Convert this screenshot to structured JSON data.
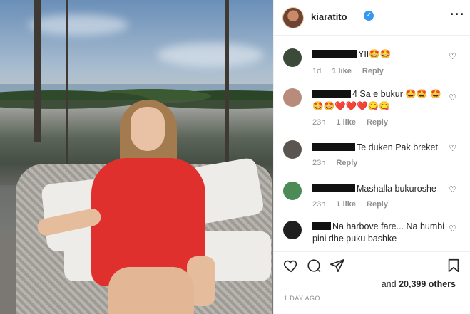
{
  "post": {
    "username": "kiaratito",
    "verified_label": "✓",
    "more_label": "···"
  },
  "comments": [
    {
      "text": "YII🤩🤩",
      "time": "1d",
      "likes": "1 like",
      "reply": "Reply",
      "avatar_color": "#3c4a3a"
    },
    {
      "text": "4 Sa e bukur 🤩🤩 🤩🤩🤩❤️❤️❤️😋😋",
      "time": "23h",
      "likes": "1 like",
      "reply": "Reply",
      "avatar_color": "#b88c7a"
    },
    {
      "text": "Te duken Pak breket",
      "time": "23h",
      "likes": "",
      "reply": "Reply",
      "avatar_color": "#5a5550"
    },
    {
      "text": "Mashalla bukuroshe",
      "time": "23h",
      "likes": "1 like",
      "reply": "Reply",
      "avatar_color": "#4c8a56"
    },
    {
      "text": "Na harbove fare... Na humbi pini dhe puku bashke",
      "time": "",
      "likes": "",
      "reply": "",
      "avatar_color": "#1f1f1f"
    }
  ],
  "actions": {
    "like_icon": "heart-icon",
    "comment_icon": "comment-icon",
    "share_icon": "share-icon",
    "save_icon": "bookmark-icon"
  },
  "likes_summary": {
    "prefix": "and ",
    "count": "20,399 others"
  },
  "date_label": "1 DAY AGO"
}
